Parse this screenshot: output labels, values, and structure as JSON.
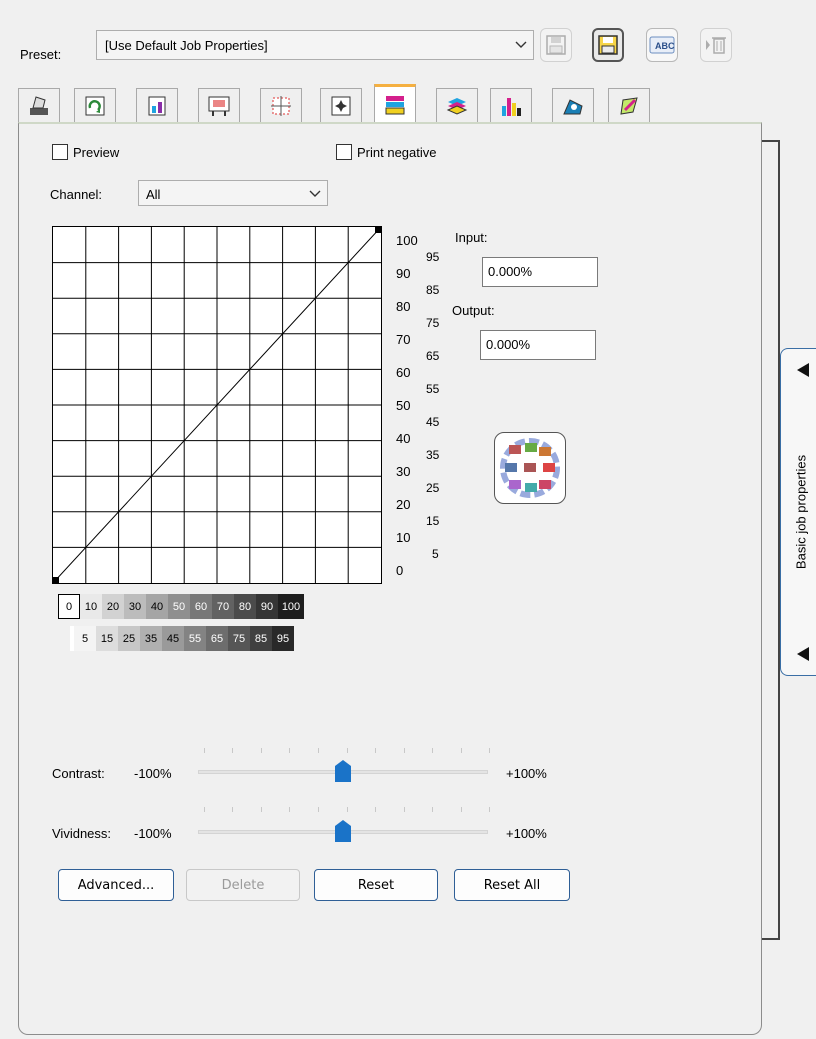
{
  "preset": {
    "label": "Preset:",
    "value": "[Use Default Job Properties]",
    "abc_icon_text": "ABC"
  },
  "toolbar_icons": [
    "save-preset-icon",
    "save-as-preset-icon",
    "rename-preset-icon",
    "delete-preset-icon"
  ],
  "tabs": [
    "layout-tab-icon",
    "rotation-tab-icon",
    "color-tab-icon",
    "media-tab-icon",
    "crop-marks-tab-icon",
    "position-tab-icon",
    "gradation-tab-icon",
    "layers-tab-icon",
    "ink-tab-icon",
    "profile-tab-icon",
    "spot-color-tab-icon"
  ],
  "active_tab_index": 6,
  "options": {
    "preview_label": "Preview",
    "print_negative_label": "Print negative",
    "preview_checked": false,
    "print_negative_checked": false
  },
  "channel": {
    "label": "Channel:",
    "value": "All"
  },
  "graph": {
    "left_scale": [
      "100",
      "90",
      "80",
      "70",
      "60",
      "50",
      "40",
      "30",
      "20",
      "10",
      "0"
    ],
    "right_scale": [
      "95",
      "85",
      "75",
      "65",
      "55",
      "45",
      "35",
      "25",
      "15",
      "5"
    ],
    "curve": [
      [
        0,
        0
      ],
      [
        100,
        100
      ]
    ]
  },
  "input": {
    "label": "Input:",
    "value": "0.000%"
  },
  "output": {
    "label": "Output:",
    "value": "0.000%"
  },
  "grey_strip": {
    "top": [
      "0",
      "10",
      "20",
      "30",
      "40",
      "50",
      "60",
      "70",
      "80",
      "90",
      "100"
    ],
    "bottom": [
      "5",
      "15",
      "25",
      "35",
      "45",
      "55",
      "65",
      "75",
      "85",
      "95"
    ]
  },
  "contrast": {
    "label": "Contrast:",
    "min": "-100%",
    "max": "+100%",
    "value": 0
  },
  "vividness": {
    "label": "Vividness:",
    "min": "-100%",
    "max": "+100%",
    "value": 0
  },
  "buttons": {
    "advanced": "Advanced...",
    "delete": "Delete",
    "reset": "Reset",
    "reset_all": "Reset All"
  },
  "drawer": {
    "label": "Basic job properties"
  }
}
